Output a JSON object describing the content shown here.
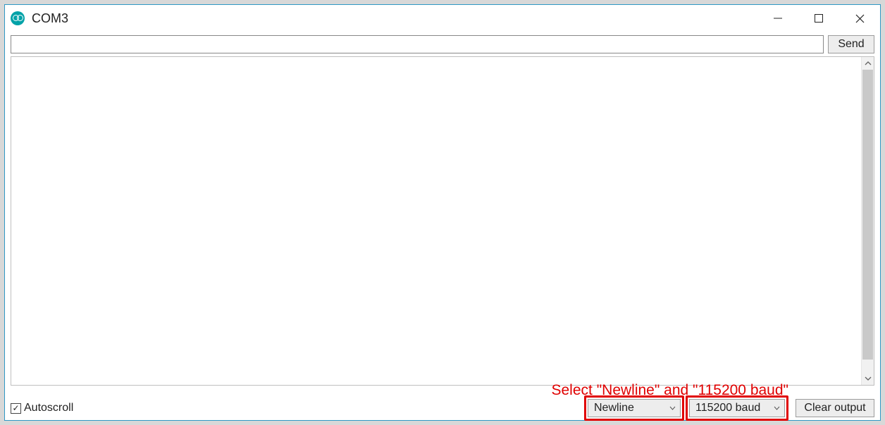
{
  "window": {
    "title": "COM3"
  },
  "input": {
    "value": "",
    "send_label": "Send"
  },
  "footer": {
    "autoscroll_label": "Autoscroll",
    "autoscroll_checked": true,
    "line_ending": "Newline",
    "baud_rate": "115200 baud",
    "clear_label": "Clear output"
  },
  "annotation": {
    "text": "Select \"Newline\" and \"115200 baud\""
  }
}
